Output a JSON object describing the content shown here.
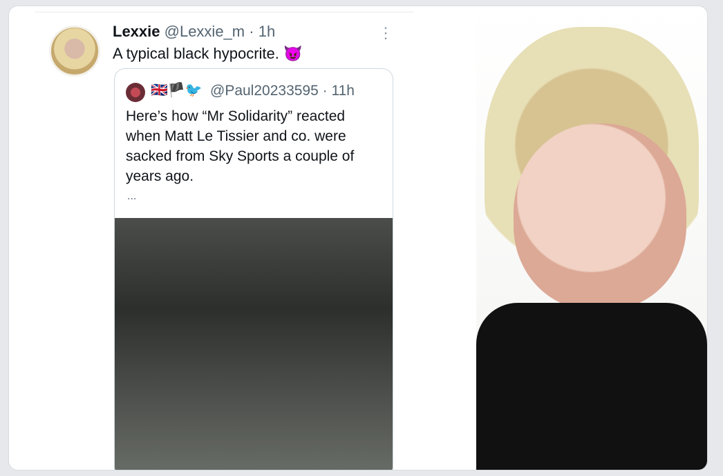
{
  "tweet": {
    "display_name": "Lexxie",
    "handle": "@Lexxie_m",
    "separator": "·",
    "time": "1h",
    "text": "A typical black hypocrite.",
    "emoji": "😈"
  },
  "quoted_tweet": {
    "flags": "🇬🇧🏴🐦",
    "handle": "@Paul20233595",
    "separator": "·",
    "time": "11h",
    "text": "Here’s how “Mr Solidarity” reacted when Matt Le Tissier and co. were sacked from Sky Sports a couple of years ago.",
    "ellipsis": "..."
  },
  "colors": {
    "text_primary": "#0f1419",
    "text_secondary": "#536471",
    "border": "#cfd9de",
    "accent": "#1d9bf0"
  },
  "icons": {
    "more": "more-options-icon",
    "emoji": "devil-face-icon",
    "bird": "twitter-bird-icon"
  }
}
